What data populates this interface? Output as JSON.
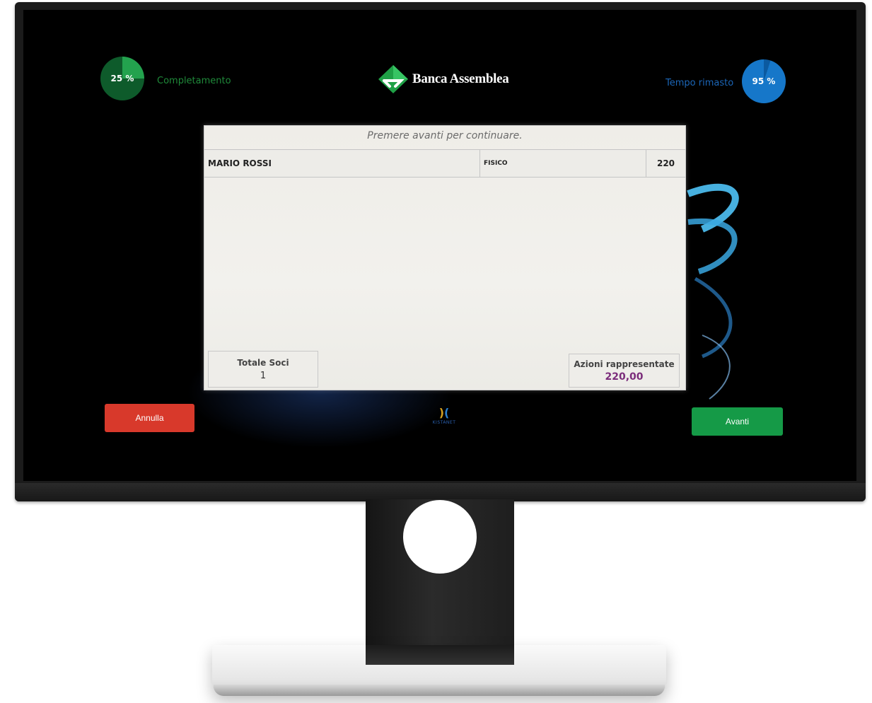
{
  "header": {
    "completion": {
      "percent_label": "25 %",
      "label": "Completamento",
      "value_percent": 25
    },
    "time_remaining": {
      "percent_label": "95 %",
      "label": "Tempo rimasto",
      "value_percent": 95
    },
    "logo_text": "Banca Assemblea"
  },
  "panel": {
    "hint": "Premere avanti per continuare.",
    "row": {
      "name": "MARIO ROSSI",
      "type": "FISICO",
      "shares": "220"
    },
    "totale_soci": {
      "label": "Totale Soci",
      "value": "1"
    },
    "azioni_rappresentate": {
      "label": "Azioni rappresentate",
      "value": "220,00"
    }
  },
  "actions": {
    "cancel_label": "Annulla",
    "next_label": "Avanti"
  },
  "footer_brand": {
    "text": "KISTANET"
  },
  "colors": {
    "completion": "#23a24e",
    "time": "#1677c9",
    "cancel": "#d8392b",
    "next": "#159a47",
    "shares_total": "#7b2d7b"
  },
  "icons": {
    "logo": "diamond-logo-icon",
    "brand": "kistanet-logo-icon"
  }
}
